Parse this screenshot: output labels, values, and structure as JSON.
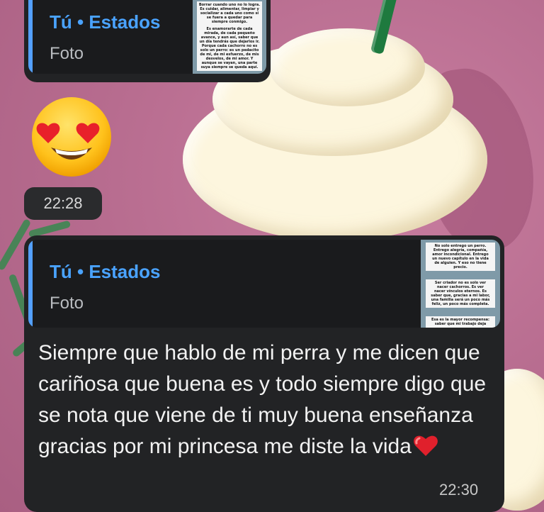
{
  "colors": {
    "bubble": "#222325",
    "quote_bg": "#1a1b1d",
    "accent": "#4aa3ff",
    "wallpaper": "#b86a8e"
  },
  "quoted_status_1": {
    "title": "Tú • Estados",
    "subtitle": "Foto",
    "thumbnail_lines": [
      "Borrar cuando uno no lo logra.",
      "Es cuidar, alimentar, limpiar y",
      "socializar a cada uno como si",
      "se fuera a quedar para",
      "siempre conmigo.",
      "Es enamorarte de cada",
      "mirada, de cada pequeño",
      "avance, y aun así, saber que",
      "un día tendrás que dejarlos ir.",
      "Porque cada cachorro no es",
      "solo un perro: es un pedacito",
      "de mi, de mi esfuerzo, de mis",
      "desvelos, de mi amor. Y",
      "aunque se vayan, una parte",
      "suya siempre se queda aquí."
    ]
  },
  "reaction_emoji": {
    "icon": "smiling-face-with-heart-eyes",
    "time": "22:28"
  },
  "message_2": {
    "quote": {
      "title": "Tú • Estados",
      "subtitle": "Foto",
      "thumbnail_lines": [
        "No solo entrego un perro.",
        "Entrego alegría, compañía,",
        "amor incondicional. Entrego",
        "un nuevo capítulo en la vida",
        "de alguien. Y eso no tiene",
        "precio.",
        "Ser criador no es solo ver",
        "nacer cachorros. Es ver",
        "nacer vínculos eternos. Es",
        "saber que, gracias a mi labor,",
        "una familia será un poco más",
        "feliz, un poco más completa.",
        "Esa es la mayor recompensa:",
        "saber que mi trabajo deja"
      ]
    },
    "text": "Siempre que hablo de mi perra y me dicen que cariñosa que buena es y todo siempre digo que se nota que viene de ti muy buena enseñanza gracias por mi princesa me diste la vida",
    "emoji": "red-heart",
    "time": "22:30"
  }
}
